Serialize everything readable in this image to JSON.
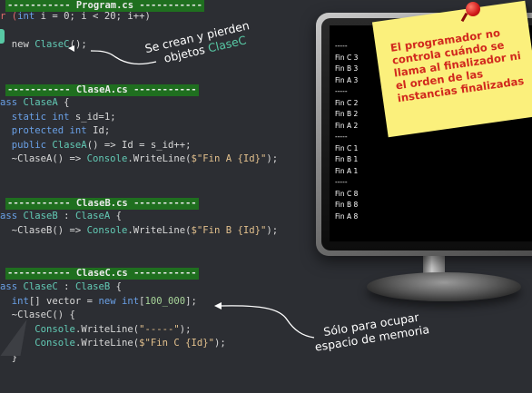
{
  "program": {
    "header": "----------- Program.cs -----------",
    "lines": [
      {
        "p": "r (",
        "kw": "int",
        "rest": " i = 0; i < 20; i++)"
      },
      {
        "p": "  new ",
        "ty": "ClaseC",
        "rest": "();"
      }
    ]
  },
  "annotation1": {
    "line1": "Se crean y pierden",
    "line2a": "objetos ",
    "line2b": "ClaseC"
  },
  "claseA": {
    "header": "----------- ClaseA.cs -----------",
    "l1a": "ass ",
    "l1b": "ClaseA",
    "l1c": " {",
    "l2a": "  static ",
    "l2b": "int",
    "l2c": " s_id=1;",
    "l3a": "  protected ",
    "l3b": "int",
    "l3c": " Id;",
    "l4a": "  public ",
    "l4b": "ClaseA",
    "l4c": "() => Id = s_id++;",
    "l5a": "  ~ClaseA() => ",
    "l5b": "Console",
    "l5c": ".WriteLine(",
    "l5d": "$\"Fin A {Id}\"",
    "l5e": ");"
  },
  "claseB": {
    "header": "----------- ClaseB.cs -----------",
    "l1a": "ass ",
    "l1b": "ClaseB",
    "l1c": " : ",
    "l1d": "ClaseA",
    "l1e": " {",
    "l2a": "  ~ClaseB() => ",
    "l2b": "Console",
    "l2c": ".WriteLine(",
    "l2d": "$\"Fin B {Id}\"",
    "l2e": ");"
  },
  "claseC": {
    "header": "----------- ClaseC.cs -----------",
    "l1a": "ass ",
    "l1b": "ClaseC",
    "l1c": " : ",
    "l1d": "ClaseB",
    "l1e": " {",
    "l2a": "  ",
    "l2b": "int",
    "l2c": "[] vector = ",
    "l2d": "new",
    "l2e": " ",
    "l2f": "int",
    "l2g": "[",
    "l2h": "100_000",
    "l2i": "];",
    "l3": "  ~ClaseC() {",
    "l4a": "      ",
    "l4b": "Console",
    "l4c": ".WriteLine(",
    "l4d": "\"-----\"",
    "l4e": ");",
    "l5a": "      ",
    "l5b": "Console",
    "l5c": ".WriteLine(",
    "l5d": "$\"Fin C {Id}\"",
    "l5e": ");",
    "l6": "  }"
  },
  "annotation2": {
    "line1": "Sólo para ocupar",
    "line2": "espacio de memoria"
  },
  "screen_output": [
    "-----",
    "Fin C 3",
    "Fin B 3",
    "Fin A 3",
    "-----",
    "Fin C 2",
    "Fin B 2",
    "Fin A 2",
    "-----",
    "Fin C 1",
    "Fin B 1",
    "Fin A 1",
    "-----",
    "Fin C 8",
    "Fin B 8",
    "Fin A 8"
  ],
  "sticky_note": {
    "text": "El programador no controla cuándo se llama al finalizador ni el orden de las instancias finalizadas"
  },
  "colors": {
    "background": "#2c2e33",
    "header_bg": "#1f6f1f",
    "keyword": "#6aa0e6",
    "type": "#62c9b4",
    "string": "#e2c08d",
    "note": "#fbf07c",
    "note_text": "#d1281d"
  }
}
